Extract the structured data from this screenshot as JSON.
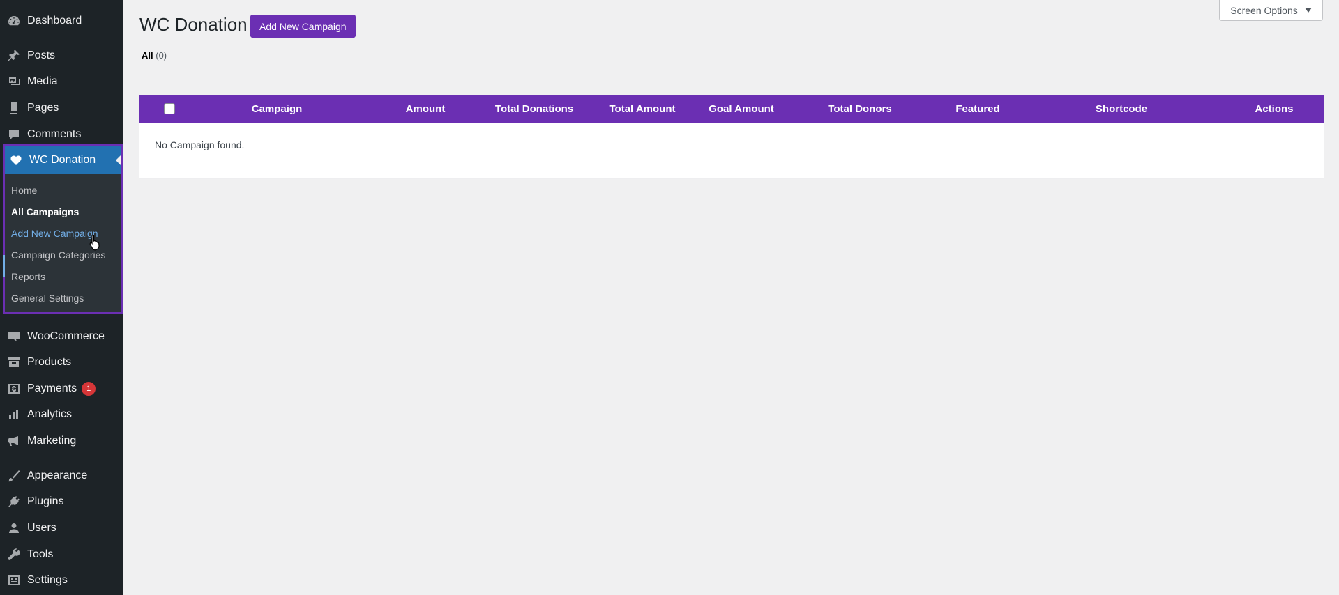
{
  "sidebar": {
    "items": [
      {
        "label": "Dashboard",
        "icon": "dashboard-icon"
      },
      {
        "label": "Posts",
        "icon": "pushpin-icon"
      },
      {
        "label": "Media",
        "icon": "media-icon"
      },
      {
        "label": "Pages",
        "icon": "pages-icon"
      },
      {
        "label": "Comments",
        "icon": "comment-icon"
      }
    ],
    "wc_donation": {
      "label": "WC Donation",
      "icon": "heart-icon",
      "submenu": [
        {
          "label": "Home"
        },
        {
          "label": "All Campaigns"
        },
        {
          "label": "Add New Campaign"
        },
        {
          "label": "Campaign Categories"
        },
        {
          "label": "Reports"
        },
        {
          "label": "General Settings"
        }
      ]
    },
    "items_after": [
      {
        "label": "WooCommerce",
        "icon": "woo-icon"
      },
      {
        "label": "Products",
        "icon": "archive-icon"
      },
      {
        "label": "Payments",
        "icon": "payments-icon",
        "badge": "1"
      },
      {
        "label": "Analytics",
        "icon": "bar-chart-icon"
      },
      {
        "label": "Marketing",
        "icon": "megaphone-icon"
      },
      {
        "label": "Appearance",
        "icon": "paintbrush-icon"
      },
      {
        "label": "Plugins",
        "icon": "plug-icon"
      },
      {
        "label": "Users",
        "icon": "user-icon"
      },
      {
        "label": "Tools",
        "icon": "wrench-icon"
      },
      {
        "label": "Settings",
        "icon": "settings-icon"
      }
    ]
  },
  "header": {
    "title": "WC Donation",
    "add_new_label": "Add New Campaign",
    "screen_options_label": "Screen Options"
  },
  "filters": {
    "all_label": "All",
    "all_count": "(0)"
  },
  "table": {
    "columns": [
      "Campaign",
      "Amount",
      "Total Donations",
      "Total Amount",
      "Goal Amount",
      "Total Donors",
      "Featured",
      "Shortcode",
      "Actions"
    ],
    "empty_message": "No Campaign found."
  },
  "colors": {
    "accent": "#6b2fb3",
    "sidebar_bg": "#1d2327",
    "active_menu": "#2271b1",
    "badge": "#d63638"
  }
}
